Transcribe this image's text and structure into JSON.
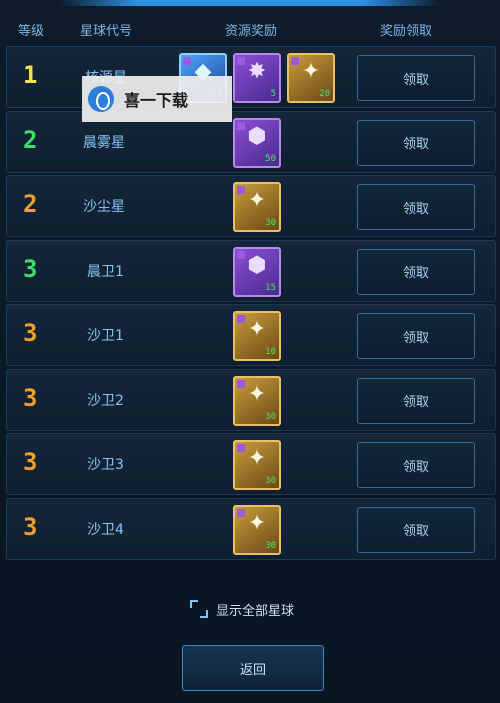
{
  "header": {
    "level": "等级",
    "planet_code": "星球代号",
    "resource_reward": "资源奖励",
    "claim_reward": "奖励领取"
  },
  "rows": [
    {
      "level": "1",
      "level_color": "#f3e24a",
      "planet": "核源星",
      "rewards": [
        {
          "icon": "diamond-icon",
          "color": "blue",
          "qty": "200"
        },
        {
          "icon": "crystal-cluster-icon",
          "color": "purple",
          "qty": "5"
        },
        {
          "icon": "gold-star-icon",
          "color": "gold",
          "qty": "20"
        }
      ],
      "claim": "领取"
    },
    {
      "level": "2",
      "level_color": "#3fe06a",
      "planet": "晨雾星",
      "rewards": [
        {
          "icon": "crystal-icon",
          "color": "purple",
          "qty": "50"
        }
      ],
      "claim": "领取"
    },
    {
      "level": "2",
      "level_color": "#f0a030",
      "planet": "沙尘星",
      "rewards": [
        {
          "icon": "gold-star-icon",
          "color": "gold",
          "qty": "30"
        }
      ],
      "claim": "领取"
    },
    {
      "level": "3",
      "level_color": "#3fe06a",
      "planet": "晨卫1",
      "rewards": [
        {
          "icon": "crystal-icon",
          "color": "purple",
          "qty": "15"
        }
      ],
      "claim": "领取"
    },
    {
      "level": "3",
      "level_color": "#f0a030",
      "planet": "沙卫1",
      "rewards": [
        {
          "icon": "gold-star-icon",
          "color": "gold",
          "qty": "10"
        }
      ],
      "claim": "领取"
    },
    {
      "level": "3",
      "level_color": "#f0a030",
      "planet": "沙卫2",
      "rewards": [
        {
          "icon": "gold-star-icon",
          "color": "gold",
          "qty": "30"
        }
      ],
      "claim": "领取"
    },
    {
      "level": "3",
      "level_color": "#f0a030",
      "planet": "沙卫3",
      "rewards": [
        {
          "icon": "gold-star-icon",
          "color": "gold",
          "qty": "30"
        }
      ],
      "claim": "领取"
    },
    {
      "level": "3",
      "level_color": "#f0a030",
      "planet": "沙卫4",
      "rewards": [
        {
          "icon": "gold-star-icon",
          "color": "gold",
          "qty": "30"
        }
      ],
      "claim": "领取"
    }
  ],
  "watermark": {
    "text": "喜一下载"
  },
  "show_all_label": "显示全部星球",
  "back_label": "返回"
}
